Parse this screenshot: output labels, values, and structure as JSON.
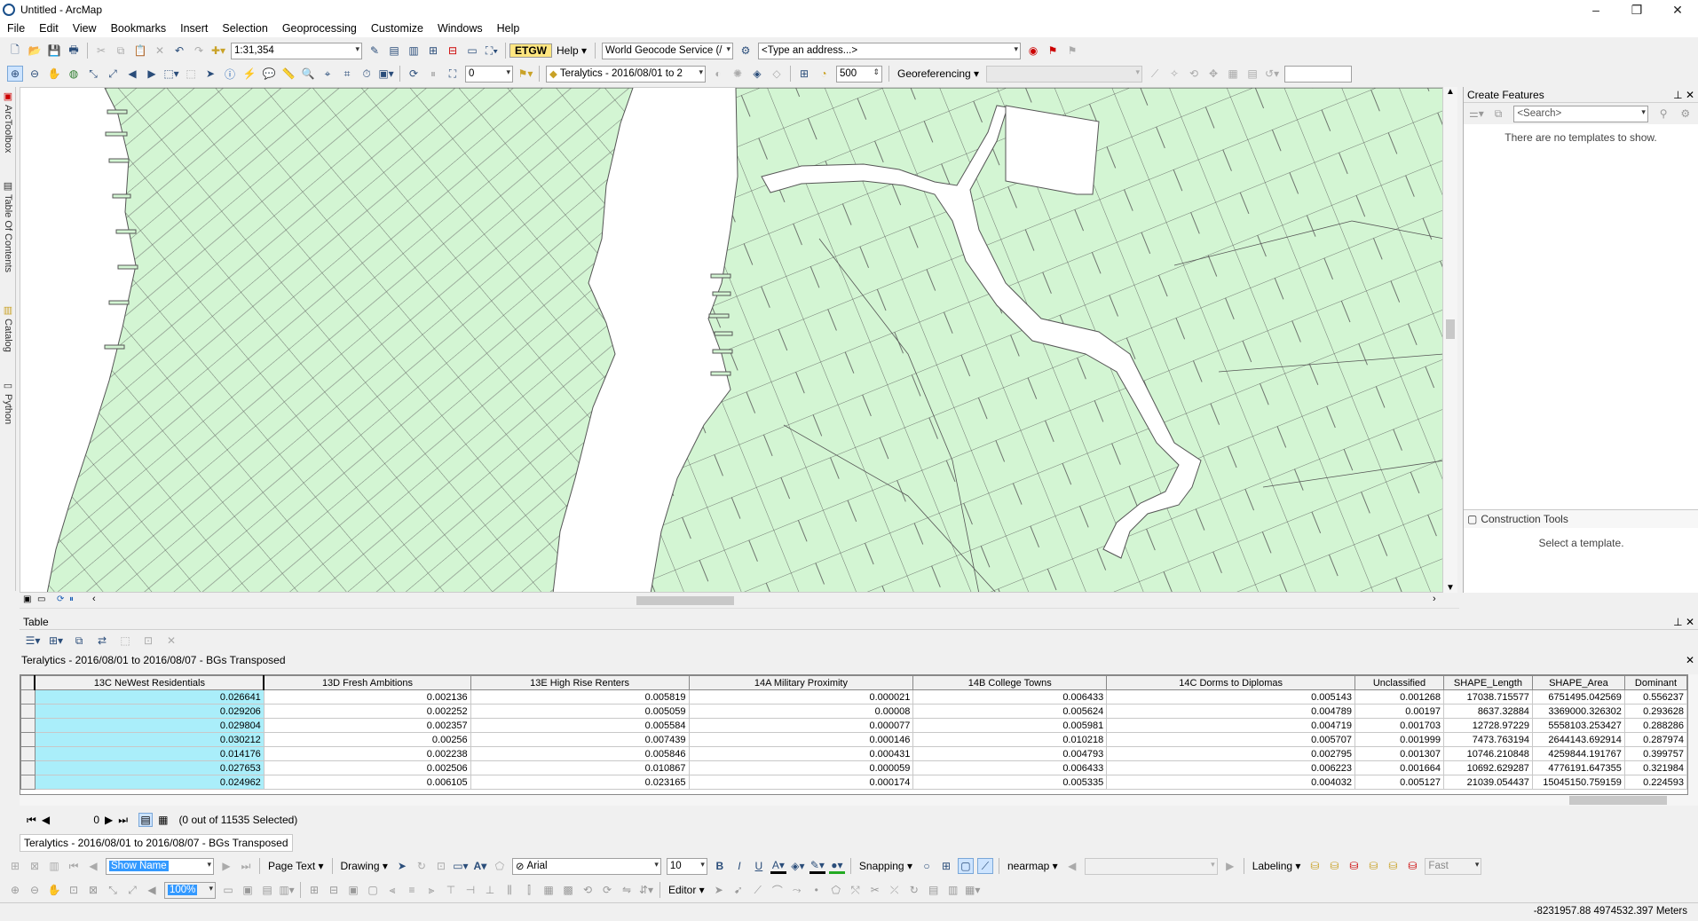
{
  "window": {
    "title": "Untitled - ArcMap",
    "minimize": "–",
    "restore": "❐",
    "close": "✕"
  },
  "menu": [
    "File",
    "Edit",
    "View",
    "Bookmarks",
    "Insert",
    "Selection",
    "Geoprocessing",
    "Customize",
    "Windows",
    "Help"
  ],
  "toolbar1": {
    "scale": "1:31,354",
    "help_label": "Help ▾",
    "geocode_service": "World Geocode Service (/",
    "address_placeholder": "<Type an address...>"
  },
  "toolbar2": {
    "zoom_field": "0",
    "layer_combo": "Teralytics - 2016/08/01 to 2",
    "distance": "500",
    "georeferencing": "Georeferencing ▾"
  },
  "left_tabs": [
    "ArcToolbox",
    "Table Of Contents",
    "Catalog",
    "Python"
  ],
  "create_features": {
    "title": "Create Features",
    "search_placeholder": "<Search>",
    "empty_message": "There are no templates to show.",
    "construction_title": "Construction Tools",
    "construction_message": "Select a template."
  },
  "table": {
    "panel_title": "Table",
    "layer_title": "Teralytics - 2016/08/01 to 2016/08/07 - BGs Transposed",
    "columns": [
      "13C NeWest Residentials",
      "13D Fresh Ambitions",
      "13E High Rise Renters",
      "14A Military Proximity",
      "14B College Towns",
      "14C Dorms to Diplomas",
      "Unclassified",
      "SHAPE_Length",
      "SHAPE_Area",
      "Dominant"
    ],
    "rows": [
      [
        "0.026641",
        "0.002136",
        "0.005819",
        "0.000021",
        "0.006433",
        "0.005143",
        "0.001268",
        "17038.715577",
        "6751495.042569",
        "0.556237"
      ],
      [
        "0.029206",
        "0.002252",
        "0.005059",
        "0.00008",
        "0.005624",
        "0.004789",
        "0.00197",
        "8637.32884",
        "3369000.326302",
        "0.293628"
      ],
      [
        "0.029804",
        "0.002357",
        "0.005584",
        "0.000077",
        "0.005981",
        "0.004719",
        "0.001703",
        "12728.97229",
        "5558103.253427",
        "0.288286"
      ],
      [
        "0.030212",
        "0.00256",
        "0.007439",
        "0.000146",
        "0.010218",
        "0.005707",
        "0.001999",
        "7473.763194",
        "2644143.692914",
        "0.287974"
      ],
      [
        "0.014176",
        "0.002238",
        "0.005846",
        "0.000431",
        "0.004793",
        "0.002795",
        "0.001307",
        "10746.210848",
        "4259844.191767",
        "0.399757"
      ],
      [
        "0.027653",
        "0.002506",
        "0.010867",
        "0.000059",
        "0.006433",
        "0.006223",
        "0.001664",
        "10692.629287",
        "4776191.647355",
        "0.321984"
      ],
      [
        "0.024962",
        "0.006105",
        "0.023165",
        "0.000174",
        "0.005335",
        "0.004032",
        "0.005127",
        "21039.054437",
        "15045150.759159",
        "0.224593"
      ]
    ],
    "record_index": "0",
    "selection_status": "(0 out of 11535 Selected)",
    "tab_label": "Teralytics - 2016/08/01 to 2016/08/07 - BGs Transposed"
  },
  "draw_toolbar": {
    "font_placeholder": "Show Name",
    "page_text": "Page Text ▾",
    "drawing": "Drawing ▾",
    "font": "Arial",
    "size": "10",
    "snapping": "Snapping ▾",
    "nearmap": "nearmap ▾",
    "labeling": "Labeling ▾",
    "fast": "Fast"
  },
  "tb3": {
    "editor": "Editor ▾",
    "zoom": "100%"
  },
  "status": {
    "coords": "-8231957.88  4974532.397 Meters"
  },
  "colors": {
    "map_fill": "#d3f5d3",
    "selected_cell": "#aaeefa"
  }
}
